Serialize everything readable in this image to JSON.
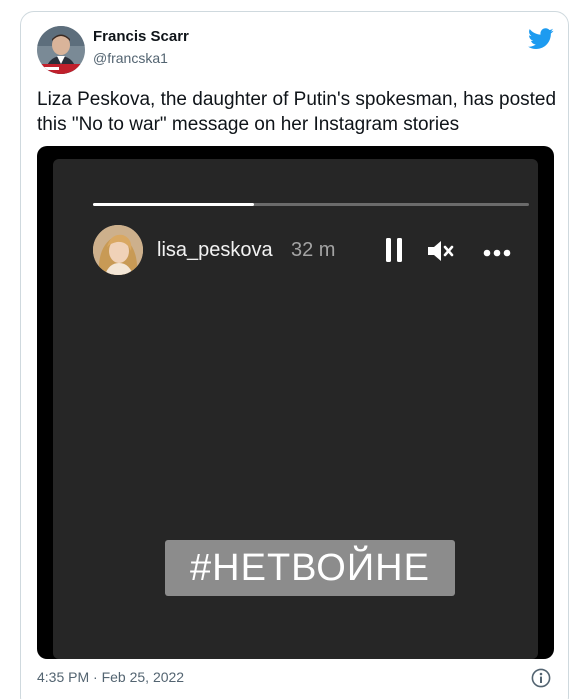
{
  "author": {
    "name": "Francis Scarr",
    "handle": "@francska1"
  },
  "tweet": {
    "text": "Liza Peskova, the daughter of Putin's spokesman, has posted this \"No to war\" message on her Instagram stories",
    "timestamp": "4:35 PM · Feb 25, 2022"
  },
  "story": {
    "username": "lisa_peskova",
    "time_ago": "32 m",
    "progress": 0.37,
    "hashtag": "#НЕТВОЙНЕ"
  },
  "icons": {
    "brand": "twitter-bird-icon",
    "pause": "pause-icon",
    "mute": "muted-speaker-icon",
    "more": "more-dots-icon",
    "info": "info-icon"
  },
  "colors": {
    "twitter_blue": "#1d9bf0",
    "text_secondary": "#536471",
    "story_background": "#262626"
  }
}
